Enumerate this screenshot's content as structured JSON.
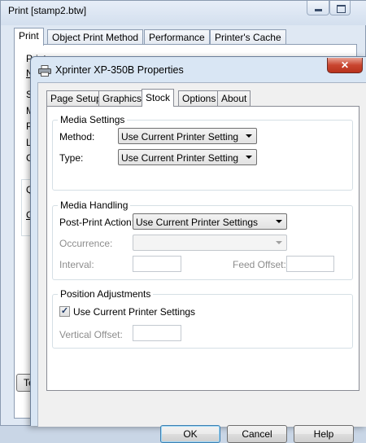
{
  "background_window": {
    "title": "Print [stamp2.btw]",
    "tabs": [
      "Print",
      "Object Print Method",
      "Performance",
      "Printer's Cache"
    ],
    "panel_text": {
      "printer_label": "Printer",
      "frag_n": "N",
      "frag_s": "S",
      "frag_m": "M",
      "frag_p": "P",
      "frag_l": "L",
      "frag_c": "C",
      "frag_q": "Q",
      "frag_c2": "C",
      "bottom_button": "Te"
    }
  },
  "dialog": {
    "title": "Xprinter XP-350B Properties",
    "close_label": "✕",
    "tabs": [
      "Page Setup",
      "Graphics",
      "Stock",
      "Options",
      "About"
    ],
    "active_tab": "Stock",
    "media_settings": {
      "title": "Media Settings",
      "method_label": "Method:",
      "method_value": "Use Current Printer Setting",
      "type_label": "Type:",
      "type_value": "Use Current Printer Setting"
    },
    "media_handling": {
      "title": "Media Handling",
      "post_print_label": "Post-Print Action:",
      "post_print_value": "Use Current Printer Settings",
      "occurrence_label": "Occurrence:",
      "occurrence_value": "",
      "interval_label": "Interval:",
      "interval_value": "",
      "feed_offset_label": "Feed Offset:",
      "feed_offset_value": ""
    },
    "position_adjustments": {
      "title": "Position Adjustments",
      "use_current_label": "Use Current Printer Settings",
      "use_current_checked": true,
      "vertical_offset_label": "Vertical Offset:",
      "vertical_offset_value": ""
    },
    "buttons": {
      "ok": "OK",
      "cancel": "Cancel",
      "help": "Help"
    }
  },
  "colors": {
    "close_button": "#c9452f",
    "dialog_frame": "#d9e6f4",
    "checkmark": "#1f3a67"
  },
  "icons": {
    "dialog_icon": "printer-icon",
    "close": "close-icon",
    "dropdown": "chevron-down-icon",
    "check": "checkmark-icon"
  }
}
